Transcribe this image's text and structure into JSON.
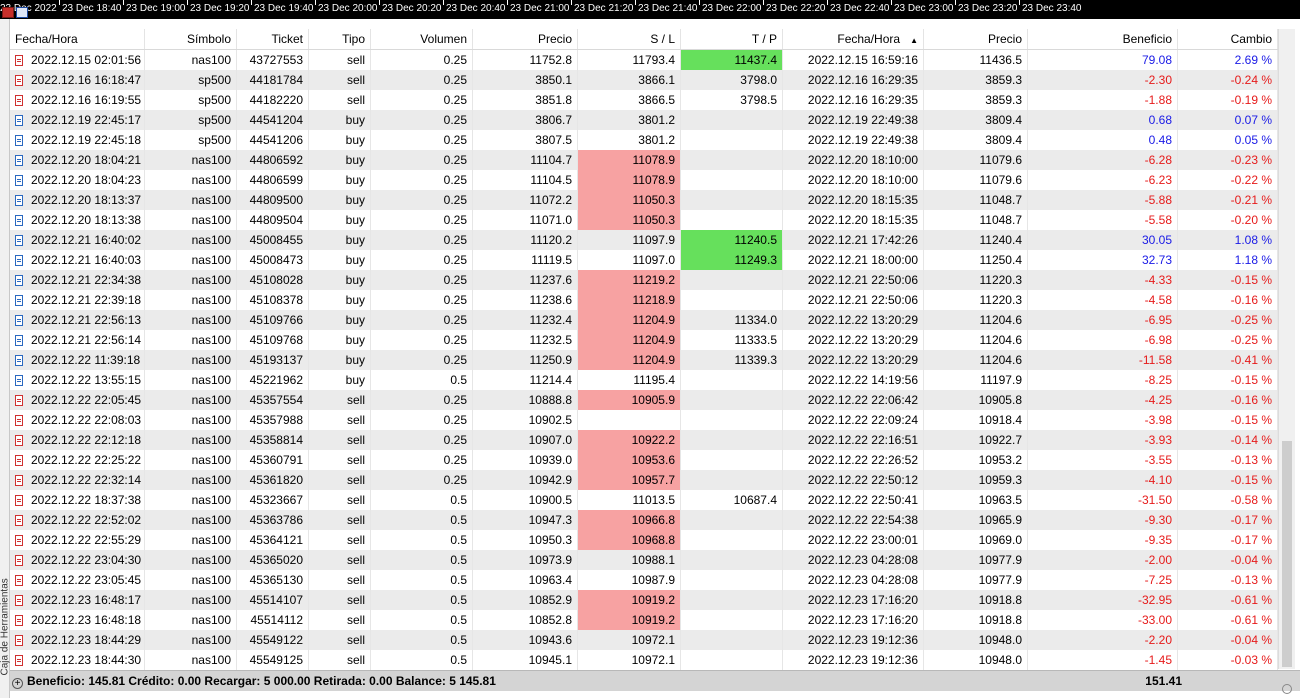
{
  "timebar": {
    "ticks": [
      "23 Dec 2022",
      "23 Dec 18:40",
      "23 Dec 19:00",
      "23 Dec 19:20",
      "23 Dec 19:40",
      "23 Dec 20:00",
      "23 Dec 20:20",
      "23 Dec 20:40",
      "23 Dec 21:00",
      "23 Dec 21:20",
      "23 Dec 21:40",
      "23 Dec 22:00",
      "23 Dec 22:20",
      "23 Dec 22:40",
      "23 Dec 23:00",
      "23 Dec 23:20",
      "23 Dec 23:40"
    ]
  },
  "toolbox_label": "Caja de Herramientas",
  "columns": [
    "Fecha/Hora",
    "Símbolo",
    "Ticket",
    "Tipo",
    "Volumen",
    "Precio",
    "S / L",
    "T / P",
    "Fecha/Hora",
    "Precio",
    "Beneficio",
    "Cambio"
  ],
  "sort_indicator": "▲",
  "rows": [
    {
      "open_time": "2022.12.15 02:01:56",
      "symbol": "nas100",
      "ticket": "43727553",
      "type": "sell",
      "volume": "0.25",
      "open_price": "11752.8",
      "sl": "11793.4",
      "sl_hit": false,
      "tp": "11437.4",
      "tp_hit": true,
      "close_time": "2022.12.15 16:59:16",
      "close_price": "11436.5",
      "profit": "79.08",
      "change": "2.69 %",
      "positive": true
    },
    {
      "open_time": "2022.12.16 16:18:47",
      "symbol": "sp500",
      "ticket": "44181784",
      "type": "sell",
      "volume": "0.25",
      "open_price": "3850.1",
      "sl": "3866.1",
      "sl_hit": false,
      "tp": "3798.0",
      "tp_hit": false,
      "close_time": "2022.12.16 16:29:35",
      "close_price": "3859.3",
      "profit": "-2.30",
      "change": "-0.24 %",
      "positive": false
    },
    {
      "open_time": "2022.12.16 16:19:55",
      "symbol": "sp500",
      "ticket": "44182220",
      "type": "sell",
      "volume": "0.25",
      "open_price": "3851.8",
      "sl": "3866.5",
      "sl_hit": false,
      "tp": "3798.5",
      "tp_hit": false,
      "close_time": "2022.12.16 16:29:35",
      "close_price": "3859.3",
      "profit": "-1.88",
      "change": "-0.19 %",
      "positive": false
    },
    {
      "open_time": "2022.12.19 22:45:17",
      "symbol": "sp500",
      "ticket": "44541204",
      "type": "buy",
      "volume": "0.25",
      "open_price": "3806.7",
      "sl": "3801.2",
      "sl_hit": false,
      "tp": "",
      "tp_hit": false,
      "close_time": "2022.12.19 22:49:38",
      "close_price": "3809.4",
      "profit": "0.68",
      "change": "0.07 %",
      "positive": true
    },
    {
      "open_time": "2022.12.19 22:45:18",
      "symbol": "sp500",
      "ticket": "44541206",
      "type": "buy",
      "volume": "0.25",
      "open_price": "3807.5",
      "sl": "3801.2",
      "sl_hit": false,
      "tp": "",
      "tp_hit": false,
      "close_time": "2022.12.19 22:49:38",
      "close_price": "3809.4",
      "profit": "0.48",
      "change": "0.05 %",
      "positive": true
    },
    {
      "open_time": "2022.12.20 18:04:21",
      "symbol": "nas100",
      "ticket": "44806592",
      "type": "buy",
      "volume": "0.25",
      "open_price": "11104.7",
      "sl": "11078.9",
      "sl_hit": true,
      "tp": "",
      "tp_hit": false,
      "close_time": "2022.12.20 18:10:00",
      "close_price": "11079.6",
      "profit": "-6.28",
      "change": "-0.23 %",
      "positive": false
    },
    {
      "open_time": "2022.12.20 18:04:23",
      "symbol": "nas100",
      "ticket": "44806599",
      "type": "buy",
      "volume": "0.25",
      "open_price": "11104.5",
      "sl": "11078.9",
      "sl_hit": true,
      "tp": "",
      "tp_hit": false,
      "close_time": "2022.12.20 18:10:00",
      "close_price": "11079.6",
      "profit": "-6.23",
      "change": "-0.22 %",
      "positive": false
    },
    {
      "open_time": "2022.12.20 18:13:37",
      "symbol": "nas100",
      "ticket": "44809500",
      "type": "buy",
      "volume": "0.25",
      "open_price": "11072.2",
      "sl": "11050.3",
      "sl_hit": true,
      "tp": "",
      "tp_hit": false,
      "close_time": "2022.12.20 18:15:35",
      "close_price": "11048.7",
      "profit": "-5.88",
      "change": "-0.21 %",
      "positive": false
    },
    {
      "open_time": "2022.12.20 18:13:38",
      "symbol": "nas100",
      "ticket": "44809504",
      "type": "buy",
      "volume": "0.25",
      "open_price": "11071.0",
      "sl": "11050.3",
      "sl_hit": true,
      "tp": "",
      "tp_hit": false,
      "close_time": "2022.12.20 18:15:35",
      "close_price": "11048.7",
      "profit": "-5.58",
      "change": "-0.20 %",
      "positive": false
    },
    {
      "open_time": "2022.12.21 16:40:02",
      "symbol": "nas100",
      "ticket": "45008455",
      "type": "buy",
      "volume": "0.25",
      "open_price": "11120.2",
      "sl": "11097.9",
      "sl_hit": false,
      "tp": "11240.5",
      "tp_hit": true,
      "close_time": "2022.12.21 17:42:26",
      "close_price": "11240.4",
      "profit": "30.05",
      "change": "1.08 %",
      "positive": true
    },
    {
      "open_time": "2022.12.21 16:40:03",
      "symbol": "nas100",
      "ticket": "45008473",
      "type": "buy",
      "volume": "0.25",
      "open_price": "11119.5",
      "sl": "11097.0",
      "sl_hit": false,
      "tp": "11249.3",
      "tp_hit": true,
      "close_time": "2022.12.21 18:00:00",
      "close_price": "11250.4",
      "profit": "32.73",
      "change": "1.18 %",
      "positive": true
    },
    {
      "open_time": "2022.12.21 22:34:38",
      "symbol": "nas100",
      "ticket": "45108028",
      "type": "buy",
      "volume": "0.25",
      "open_price": "11237.6",
      "sl": "11219.2",
      "sl_hit": true,
      "tp": "",
      "tp_hit": false,
      "close_time": "2022.12.21 22:50:06",
      "close_price": "11220.3",
      "profit": "-4.33",
      "change": "-0.15 %",
      "positive": false
    },
    {
      "open_time": "2022.12.21 22:39:18",
      "symbol": "nas100",
      "ticket": "45108378",
      "type": "buy",
      "volume": "0.25",
      "open_price": "11238.6",
      "sl": "11218.9",
      "sl_hit": true,
      "tp": "",
      "tp_hit": false,
      "close_time": "2022.12.21 22:50:06",
      "close_price": "11220.3",
      "profit": "-4.58",
      "change": "-0.16 %",
      "positive": false
    },
    {
      "open_time": "2022.12.21 22:56:13",
      "symbol": "nas100",
      "ticket": "45109766",
      "type": "buy",
      "volume": "0.25",
      "open_price": "11232.4",
      "sl": "11204.9",
      "sl_hit": true,
      "tp": "11334.0",
      "tp_hit": false,
      "close_time": "2022.12.22 13:20:29",
      "close_price": "11204.6",
      "profit": "-6.95",
      "change": "-0.25 %",
      "positive": false
    },
    {
      "open_time": "2022.12.21 22:56:14",
      "symbol": "nas100",
      "ticket": "45109768",
      "type": "buy",
      "volume": "0.25",
      "open_price": "11232.5",
      "sl": "11204.9",
      "sl_hit": true,
      "tp": "11333.5",
      "tp_hit": false,
      "close_time": "2022.12.22 13:20:29",
      "close_price": "11204.6",
      "profit": "-6.98",
      "change": "-0.25 %",
      "positive": false
    },
    {
      "open_time": "2022.12.22 11:39:18",
      "symbol": "nas100",
      "ticket": "45193137",
      "type": "buy",
      "volume": "0.25",
      "open_price": "11250.9",
      "sl": "11204.9",
      "sl_hit": true,
      "tp": "11339.3",
      "tp_hit": false,
      "close_time": "2022.12.22 13:20:29",
      "close_price": "11204.6",
      "profit": "-11.58",
      "change": "-0.41 %",
      "positive": false
    },
    {
      "open_time": "2022.12.22 13:55:15",
      "symbol": "nas100",
      "ticket": "45221962",
      "type": "buy",
      "volume": "0.5",
      "open_price": "11214.4",
      "sl": "11195.4",
      "sl_hit": false,
      "tp": "",
      "tp_hit": false,
      "close_time": "2022.12.22 14:19:56",
      "close_price": "11197.9",
      "profit": "-8.25",
      "change": "-0.15 %",
      "positive": false
    },
    {
      "open_time": "2022.12.22 22:05:45",
      "symbol": "nas100",
      "ticket": "45357554",
      "type": "sell",
      "volume": "0.25",
      "open_price": "10888.8",
      "sl": "10905.9",
      "sl_hit": true,
      "tp": "",
      "tp_hit": false,
      "close_time": "2022.12.22 22:06:42",
      "close_price": "10905.8",
      "profit": "-4.25",
      "change": "-0.16 %",
      "positive": false
    },
    {
      "open_time": "2022.12.22 22:08:03",
      "symbol": "nas100",
      "ticket": "45357988",
      "type": "sell",
      "volume": "0.25",
      "open_price": "10902.5",
      "sl": "",
      "sl_hit": false,
      "tp": "",
      "tp_hit": false,
      "close_time": "2022.12.22 22:09:24",
      "close_price": "10918.4",
      "profit": "-3.98",
      "change": "-0.15 %",
      "positive": false
    },
    {
      "open_time": "2022.12.22 22:12:18",
      "symbol": "nas100",
      "ticket": "45358814",
      "type": "sell",
      "volume": "0.25",
      "open_price": "10907.0",
      "sl": "10922.2",
      "sl_hit": true,
      "tp": "",
      "tp_hit": false,
      "close_time": "2022.12.22 22:16:51",
      "close_price": "10922.7",
      "profit": "-3.93",
      "change": "-0.14 %",
      "positive": false
    },
    {
      "open_time": "2022.12.22 22:25:22",
      "symbol": "nas100",
      "ticket": "45360791",
      "type": "sell",
      "volume": "0.25",
      "open_price": "10939.0",
      "sl": "10953.6",
      "sl_hit": true,
      "tp": "",
      "tp_hit": false,
      "close_time": "2022.12.22 22:26:52",
      "close_price": "10953.2",
      "profit": "-3.55",
      "change": "-0.13 %",
      "positive": false
    },
    {
      "open_time": "2022.12.22 22:32:14",
      "symbol": "nas100",
      "ticket": "45361820",
      "type": "sell",
      "volume": "0.25",
      "open_price": "10942.9",
      "sl": "10957.7",
      "sl_hit": true,
      "tp": "",
      "tp_hit": false,
      "close_time": "2022.12.22 22:50:12",
      "close_price": "10959.3",
      "profit": "-4.10",
      "change": "-0.15 %",
      "positive": false
    },
    {
      "open_time": "2022.12.22 18:37:38",
      "symbol": "nas100",
      "ticket": "45323667",
      "type": "sell",
      "volume": "0.5",
      "open_price": "10900.5",
      "sl": "11013.5",
      "sl_hit": false,
      "tp": "10687.4",
      "tp_hit": false,
      "close_time": "2022.12.22 22:50:41",
      "close_price": "10963.5",
      "profit": "-31.50",
      "change": "-0.58 %",
      "positive": false
    },
    {
      "open_time": "2022.12.22 22:52:02",
      "symbol": "nas100",
      "ticket": "45363786",
      "type": "sell",
      "volume": "0.5",
      "open_price": "10947.3",
      "sl": "10966.8",
      "sl_hit": true,
      "tp": "",
      "tp_hit": false,
      "close_time": "2022.12.22 22:54:38",
      "close_price": "10965.9",
      "profit": "-9.30",
      "change": "-0.17 %",
      "positive": false
    },
    {
      "open_time": "2022.12.22 22:55:29",
      "symbol": "nas100",
      "ticket": "45364121",
      "type": "sell",
      "volume": "0.5",
      "open_price": "10950.3",
      "sl": "10968.8",
      "sl_hit": true,
      "tp": "",
      "tp_hit": false,
      "close_time": "2022.12.22 23:00:01",
      "close_price": "10969.0",
      "profit": "-9.35",
      "change": "-0.17 %",
      "positive": false
    },
    {
      "open_time": "2022.12.22 23:04:30",
      "symbol": "nas100",
      "ticket": "45365020",
      "type": "sell",
      "volume": "0.5",
      "open_price": "10973.9",
      "sl": "10988.1",
      "sl_hit": false,
      "tp": "",
      "tp_hit": false,
      "close_time": "2022.12.23 04:28:08",
      "close_price": "10977.9",
      "profit": "-2.00",
      "change": "-0.04 %",
      "positive": false
    },
    {
      "open_time": "2022.12.22 23:05:45",
      "symbol": "nas100",
      "ticket": "45365130",
      "type": "sell",
      "volume": "0.5",
      "open_price": "10963.4",
      "sl": "10987.9",
      "sl_hit": false,
      "tp": "",
      "tp_hit": false,
      "close_time": "2022.12.23 04:28:08",
      "close_price": "10977.9",
      "profit": "-7.25",
      "change": "-0.13 %",
      "positive": false
    },
    {
      "open_time": "2022.12.23 16:48:17",
      "symbol": "nas100",
      "ticket": "45514107",
      "type": "sell",
      "volume": "0.5",
      "open_price": "10852.9",
      "sl": "10919.2",
      "sl_hit": true,
      "tp": "",
      "tp_hit": false,
      "close_time": "2022.12.23 17:16:20",
      "close_price": "10918.8",
      "profit": "-32.95",
      "change": "-0.61 %",
      "positive": false
    },
    {
      "open_time": "2022.12.23 16:48:18",
      "symbol": "nas100",
      "ticket": "45514112",
      "type": "sell",
      "volume": "0.5",
      "open_price": "10852.8",
      "sl": "10919.2",
      "sl_hit": true,
      "tp": "",
      "tp_hit": false,
      "close_time": "2022.12.23 17:16:20",
      "close_price": "10918.8",
      "profit": "-33.00",
      "change": "-0.61 %",
      "positive": false
    },
    {
      "open_time": "2022.12.23 18:44:29",
      "symbol": "nas100",
      "ticket": "45549122",
      "type": "sell",
      "volume": "0.5",
      "open_price": "10943.6",
      "sl": "10972.1",
      "sl_hit": false,
      "tp": "",
      "tp_hit": false,
      "close_time": "2022.12.23 19:12:36",
      "close_price": "10948.0",
      "profit": "-2.20",
      "change": "-0.04 %",
      "positive": false
    },
    {
      "open_time": "2022.12.23 18:44:30",
      "symbol": "nas100",
      "ticket": "45549125",
      "type": "sell",
      "volume": "0.5",
      "open_price": "10945.1",
      "sl": "10972.1",
      "sl_hit": false,
      "tp": "",
      "tp_hit": false,
      "close_time": "2022.12.23 19:12:36",
      "close_price": "10948.0",
      "profit": "-1.45",
      "change": "-0.03 %",
      "positive": false
    }
  ],
  "summary": {
    "text": "Beneficio: 145.81  Crédito: 0.00  Recargar: 5 000.00  Retirada: 0.00  Balance: 5 145.81",
    "total": "151.41"
  },
  "colors": {
    "sl_hit": "#f7a2a2",
    "tp_hit": "#66e05c",
    "positive": "#1a1ae6",
    "negative": "#e61a1a"
  }
}
